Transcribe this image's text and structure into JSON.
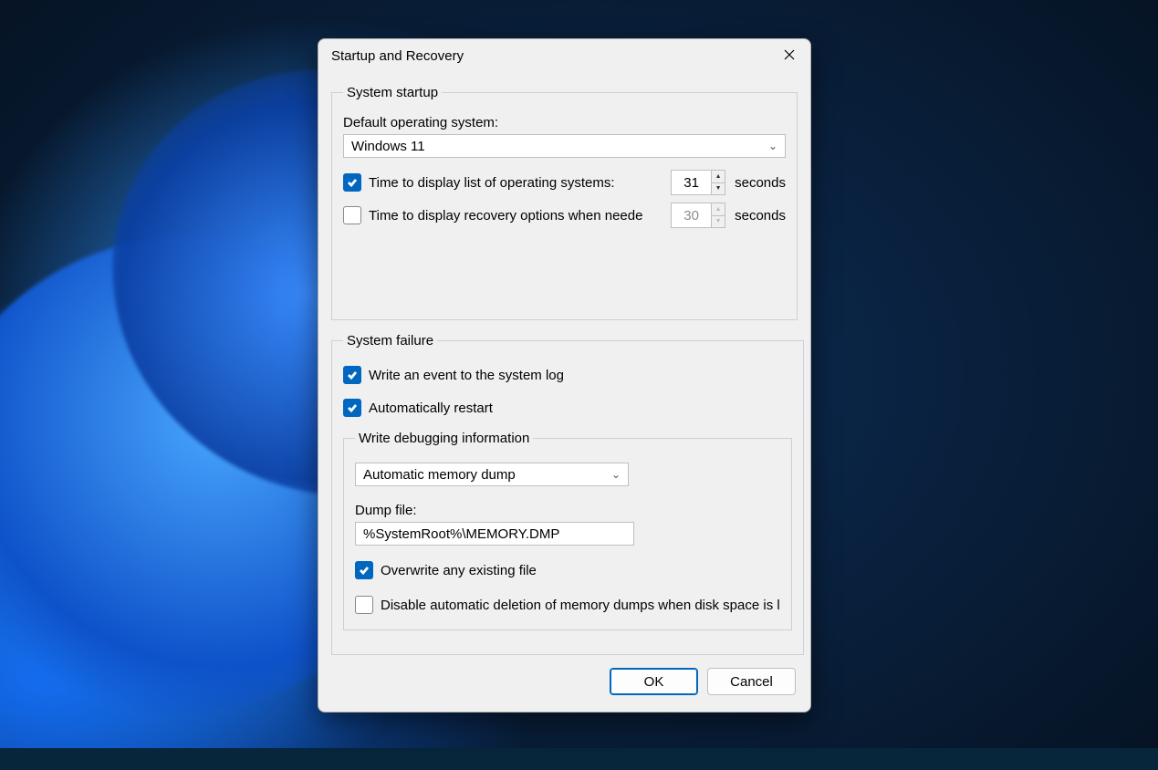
{
  "dialog": {
    "title": "Startup and Recovery",
    "buttons": {
      "ok": "OK",
      "cancel": "Cancel"
    }
  },
  "startup": {
    "legend": "System startup",
    "default_os_label": "Default operating system:",
    "default_os_value": "Windows 11",
    "display_os_list": {
      "checked": true,
      "label": "Time to display list of operating systems:",
      "value": "31",
      "unit": "seconds"
    },
    "display_recovery": {
      "checked": false,
      "label": "Time to display recovery options when needed",
      "value": "30",
      "unit": "seconds"
    }
  },
  "failure": {
    "legend": "System failure",
    "write_event": {
      "checked": true,
      "label": "Write an event to the system log"
    },
    "auto_restart": {
      "checked": true,
      "label": "Automatically restart"
    },
    "debug_info": {
      "legend": "Write debugging information",
      "type_value": "Automatic memory dump",
      "dump_file_label": "Dump file:",
      "dump_file_value": "%SystemRoot%\\MEMORY.DMP",
      "overwrite": {
        "checked": true,
        "label": "Overwrite any existing file"
      },
      "disable_delete": {
        "checked": false,
        "label": "Disable automatic deletion of memory dumps when disk space is l"
      }
    }
  }
}
